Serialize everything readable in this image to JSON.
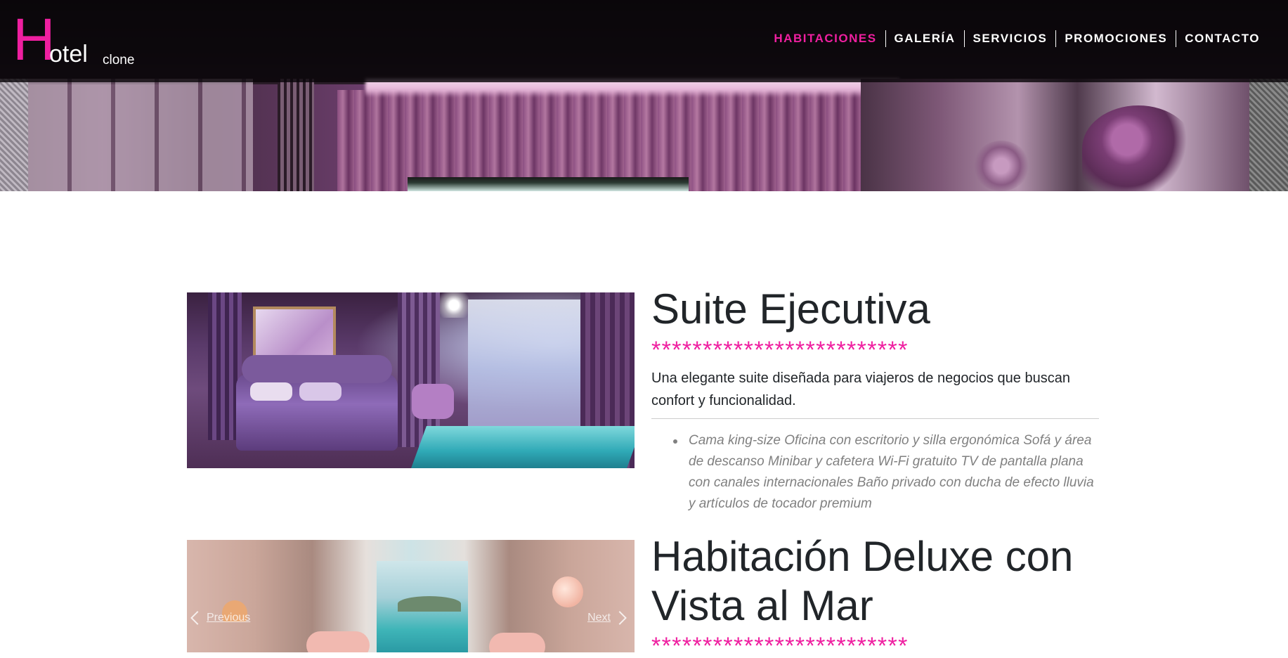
{
  "brand": {
    "initial": "H",
    "name": "otel",
    "suffix": "clone"
  },
  "nav": {
    "items": [
      {
        "label": "HABITACIONES",
        "active": true
      },
      {
        "label": "GALERÍA",
        "active": false
      },
      {
        "label": "SERVICIOS",
        "active": false
      },
      {
        "label": "PROMOCIONES",
        "active": false
      },
      {
        "label": "CONTACTO",
        "active": false
      }
    ]
  },
  "colors": {
    "accent": "#ef1fa0",
    "text": "#212529",
    "muted": "#808080",
    "nav_bg": "rgba(10,6,10,0.82)"
  },
  "rooms": [
    {
      "title": "Suite Ejecutiva",
      "stars": "*************************",
      "description": "Una elegante suite diseñada para viajeros de negocios que buscan confort y funcionalidad.",
      "amenities": "Cama king-size Oficina con escritorio y silla ergonómica Sofá y área de descanso Minibar y cafetera Wi-Fi gratuito TV de pantalla plana con canales internacionales Baño privado con ducha de efecto lluvia y artículos de tocador premium"
    },
    {
      "title": "Habitación Deluxe con Vista al Mar",
      "stars": "*************************",
      "carousel": {
        "prev_label": "Previous",
        "next_label": "Next"
      }
    }
  ]
}
